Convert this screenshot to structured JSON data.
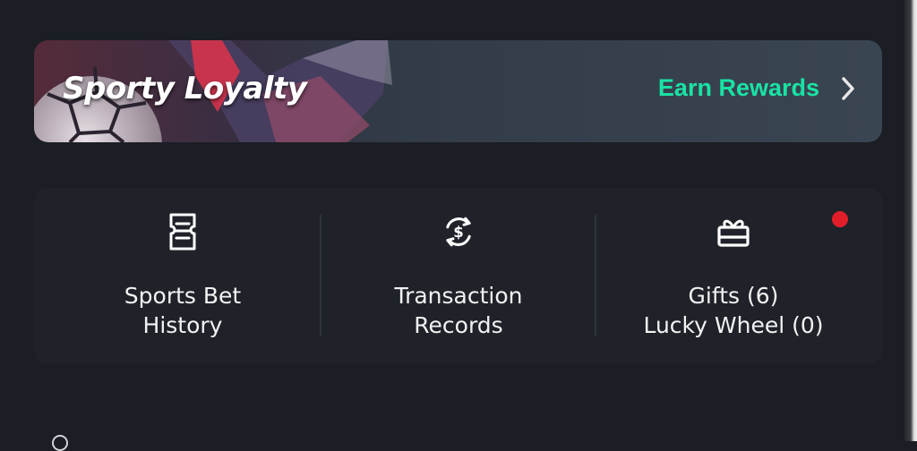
{
  "banner": {
    "title": "Sporty Loyalty",
    "cta": "Earn Rewards",
    "accent": "#19e3a4"
  },
  "actions": {
    "bet_history": {
      "line1": "Sports Bet",
      "line2": "History",
      "icon": "ticket-icon"
    },
    "transactions": {
      "line1": "Transaction",
      "line2": "Records",
      "icon": "dollar-refresh-icon"
    },
    "gifts": {
      "line1": "Gifts (6)",
      "line2": "Lucky Wheel (0)",
      "icon": "gift-icon",
      "notification_color": "#e11d2a"
    }
  }
}
